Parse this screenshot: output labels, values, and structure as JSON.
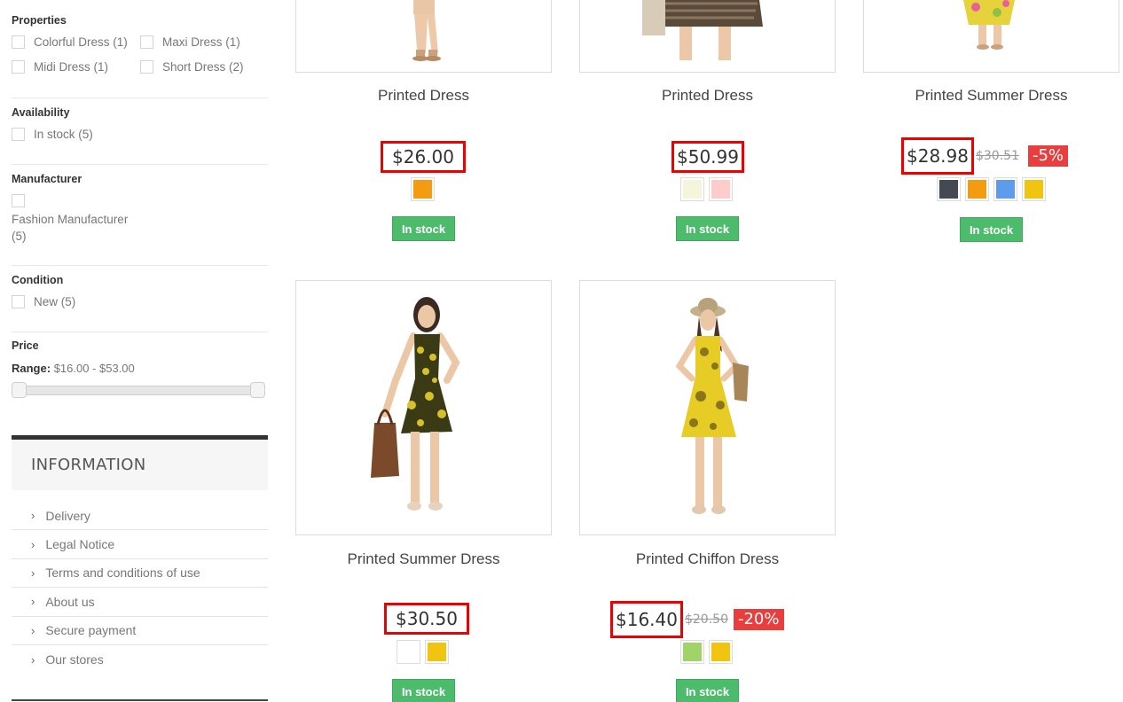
{
  "filters": {
    "properties": {
      "title": "Properties",
      "options": [
        {
          "label": "Colorful Dress (1)"
        },
        {
          "label": "Maxi Dress (1)"
        },
        {
          "label": "Midi Dress (1)"
        },
        {
          "label": "Short Dress (2)"
        }
      ]
    },
    "availability": {
      "title": "Availability",
      "options": [
        {
          "label": "In stock (5)"
        }
      ]
    },
    "manufacturer": {
      "title": "Manufacturer",
      "options": [
        {
          "label": "Fashion Manufacturer",
          "count": "(5)"
        }
      ]
    },
    "condition": {
      "title": "Condition",
      "options": [
        {
          "label": "New (5)"
        }
      ]
    },
    "price": {
      "title": "Price",
      "range_label": "Range:",
      "range_value": "$16.00 - $53.00"
    }
  },
  "information": {
    "title": "INFORMATION",
    "chevron": "›",
    "items": [
      {
        "label": "Delivery"
      },
      {
        "label": "Legal Notice"
      },
      {
        "label": "Terms and conditions of use"
      },
      {
        "label": "About us"
      },
      {
        "label": "Secure payment"
      },
      {
        "label": "Our stores"
      }
    ]
  },
  "products": [
    {
      "name": "Printed Dress",
      "price": "$26.00",
      "old_price": "",
      "discount": "",
      "colors": [
        "#f39c11"
      ],
      "stock": "In stock"
    },
    {
      "name": "Printed Dress",
      "price": "$50.99",
      "old_price": "",
      "discount": "",
      "colors": [
        "#f5f5dc",
        "#fcc"
      ],
      "stock": "In stock"
    },
    {
      "name": "Printed Summer Dress",
      "price": "$28.98",
      "old_price": "$30.51",
      "discount": "-5%",
      "colors": [
        "#434a54",
        "#f39c11",
        "#5d9cec",
        "#f1c40f"
      ],
      "stock": "In stock"
    },
    {
      "name": "Printed Summer Dress",
      "price": "$30.50",
      "old_price": "",
      "discount": "",
      "colors": [
        "#ffffff",
        "#f1c40f"
      ],
      "stock": "In stock"
    },
    {
      "name": "Printed Chiffon Dress",
      "price": "$16.40",
      "old_price": "$20.50",
      "discount": "-20%",
      "colors": [
        "#a0d468",
        "#f1c40f"
      ],
      "stock": "In stock"
    }
  ],
  "colors": {
    "stock_green": "#4cbb6c",
    "discount_red": "#e83e3e",
    "highlight_red": "#ee0000"
  }
}
